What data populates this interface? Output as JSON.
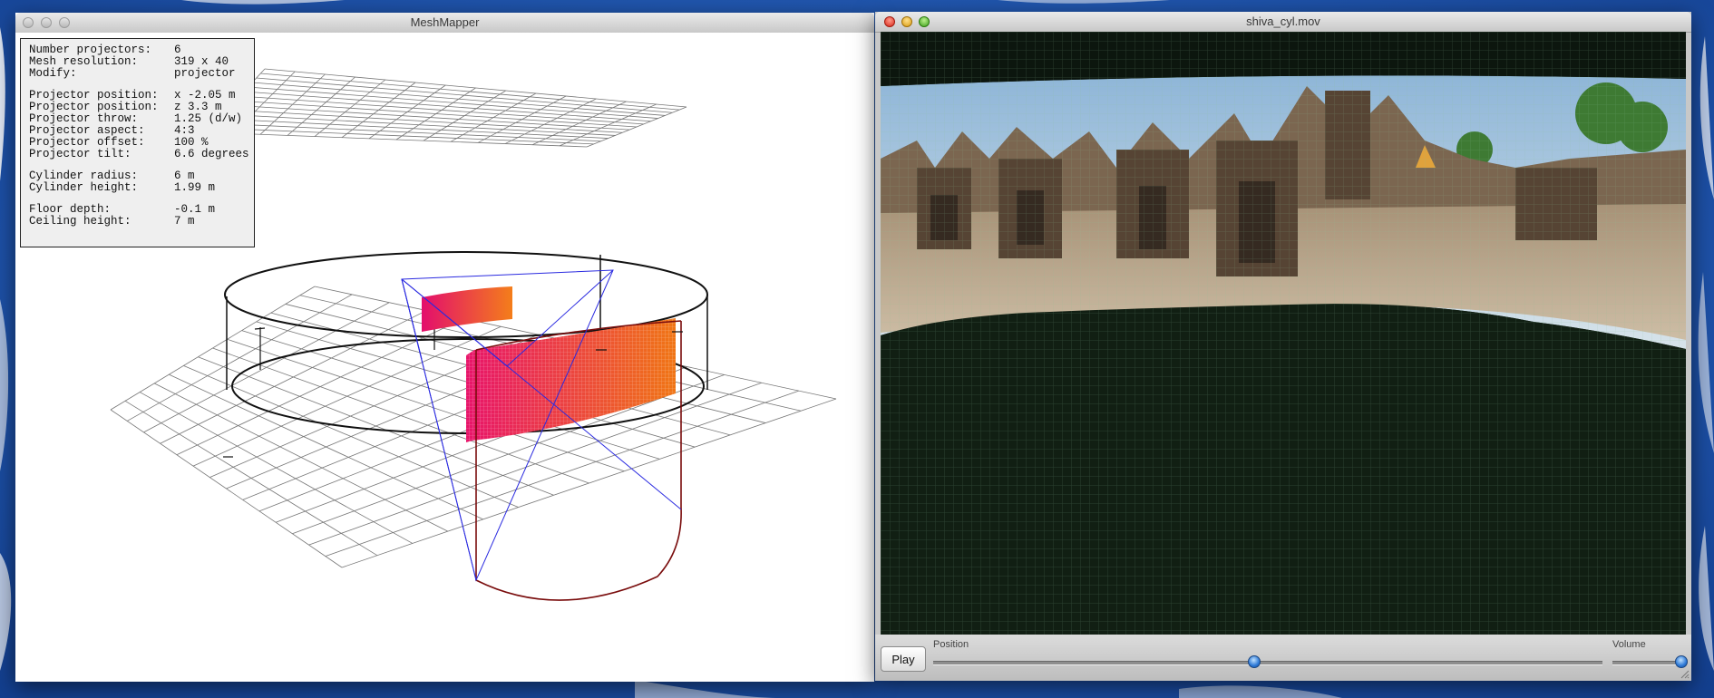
{
  "meshmapper_window": {
    "title": "MeshMapper",
    "info_panel": {
      "groups": [
        [
          {
            "label": "Number projectors:",
            "value": "6"
          },
          {
            "label": "Mesh resolution:",
            "value": "319 x 40"
          },
          {
            "label": "Modify:",
            "value": "projector"
          }
        ],
        [
          {
            "label": "Projector position:",
            "value": "x -2.05 m"
          },
          {
            "label": "Projector position:",
            "value": "z 3.3 m"
          },
          {
            "label": "Projector throw:",
            "value": "1.25 (d/w)"
          },
          {
            "label": "Projector aspect:",
            "value": "4:3"
          },
          {
            "label": "Projector offset:",
            "value": "100 %"
          },
          {
            "label": "Projector tilt:",
            "value": "6.6 degrees"
          }
        ],
        [
          {
            "label": "Cylinder radius:",
            "value": "6 m"
          },
          {
            "label": "Cylinder height:",
            "value": "1.99 m"
          }
        ],
        [
          {
            "label": "Floor depth:",
            "value": "-0.1 m"
          },
          {
            "label": "Ceiling height:",
            "value": "7 m"
          }
        ]
      ]
    }
  },
  "movie_window": {
    "title": "shiva_cyl.mov",
    "controls": {
      "play_label": "Play",
      "position_label": "Position",
      "volume_label": "Volume",
      "position_fraction": 0.48,
      "volume_fraction": 1.0
    }
  },
  "colors": {
    "desktop_blue": "#1d4fa8",
    "projector_frustum": "#2a2ae0",
    "cylinder_outline": "#7a0d0d",
    "mesh_gradient_start": "#e8146a",
    "mesh_gradient_end": "#f06a14"
  },
  "icons": [
    "close-button-icon",
    "minimize-button-icon",
    "zoom-button-icon",
    "resize-grip-icon"
  ]
}
